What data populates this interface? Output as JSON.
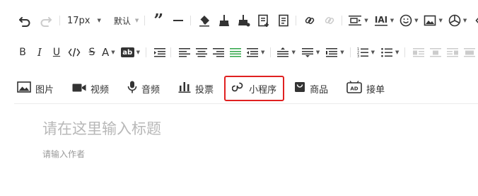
{
  "toolbar_row1": {
    "font_size": "17px",
    "font_family": "默认",
    "icons": [
      "undo-icon",
      "redo-icon",
      "blockquote-icon",
      "horizontal-rule-icon",
      "clear-format-icon",
      "format-painter-icon",
      "format-painter-alt-icon",
      "insert-template-icon",
      "document-icon",
      "link-icon",
      "unlink-icon",
      "paragraph-spacing-icon",
      "text-indent-icon",
      "emoji-icon",
      "image-icon",
      "third-party-icon",
      "code-icon"
    ]
  },
  "toolbar_row2": {
    "icons": [
      "bold-icon",
      "italic-icon",
      "underline-icon",
      "code-inline-icon",
      "strikethrough-icon",
      "font-color-icon",
      "background-color-icon",
      "indent-icon",
      "align-left-icon",
      "align-center-icon",
      "align-right-icon",
      "align-justify-icon",
      "text-direction-icon",
      "line-height-icon",
      "paragraph-before-icon",
      "paragraph-after-icon",
      "ordered-list-icon",
      "unordered-list-icon",
      "column-left-icon",
      "column-center-icon",
      "column-right-icon",
      "column-justify-icon"
    ],
    "colors": {
      "justify_active": "#2fa547",
      "disabled": "#c8c8c8"
    }
  },
  "media_bar": {
    "items": [
      {
        "icon": "picture-icon",
        "label": "图片"
      },
      {
        "icon": "video-icon",
        "label": "视频"
      },
      {
        "icon": "microphone-icon",
        "label": "音频"
      },
      {
        "icon": "poll-icon",
        "label": "投票"
      },
      {
        "icon": "mini-program-icon",
        "label": "小程序"
      },
      {
        "icon": "product-icon",
        "label": "商品"
      },
      {
        "icon": "ad-icon",
        "label": "接单"
      }
    ],
    "highlight_color": "#e02020"
  },
  "editor": {
    "title_placeholder": "请在这里输入标题",
    "author_placeholder": "请输入作者"
  }
}
